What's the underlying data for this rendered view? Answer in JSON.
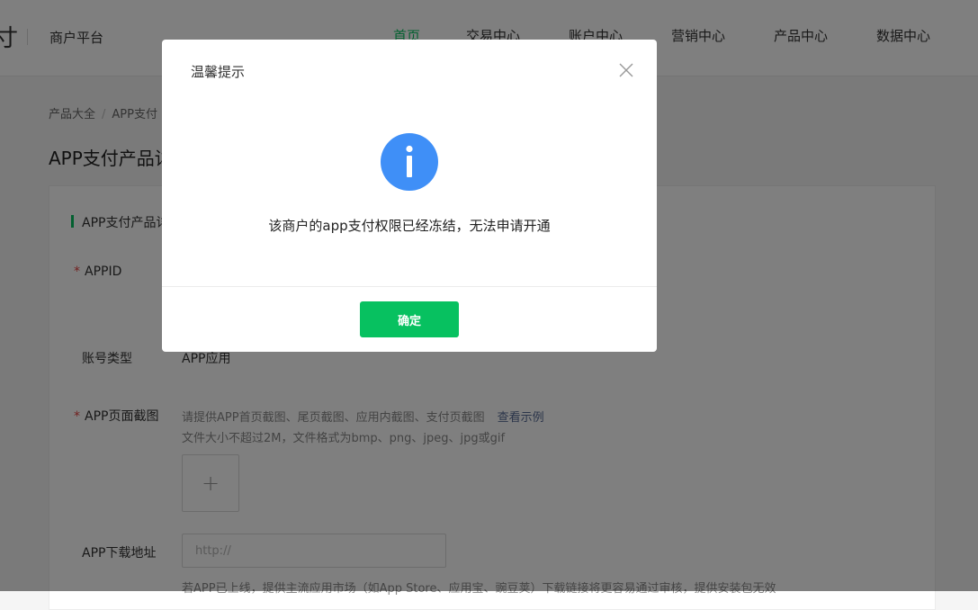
{
  "header": {
    "logo_fragment": "寸",
    "platform": "商户平台",
    "nav": [
      {
        "label": "首页",
        "active": true
      },
      {
        "label": "交易中心"
      },
      {
        "label": "账户中心"
      },
      {
        "label": "营销中心"
      },
      {
        "label": "产品中心"
      },
      {
        "label": "数据中心"
      }
    ]
  },
  "breadcrumb": [
    "产品大全",
    "APP支付"
  ],
  "page_title": "APP支付产品详",
  "section_title": "APP支付产品详",
  "form": {
    "appid_label": "APPID",
    "account_type_label": "账号类型",
    "account_type_value": "APP应用",
    "screenshots_label": "APP页面截图",
    "screenshots_hint": "请提供APP首页截图、尾页截图、应用内截图、支付页截图",
    "screenshots_link": "查看示例",
    "screenshots_hint2": "文件大小不超过2M，文件格式为bmp、png、jpeg、jpg或gif",
    "upload_plus": "+",
    "download_label": "APP下载地址",
    "download_placeholder": "http://",
    "download_hint": "若APP已上线，提供主流应用市场（如App Store、应用宝、豌豆荚）下载链接将更容易通过审核，提供安装包无效"
  },
  "modal": {
    "title": "温馨提示",
    "message": "该商户的app支付权限已经冻结，无法申请开通",
    "confirm_label": "确定",
    "icon": "info-icon",
    "close_icon": "close-icon"
  },
  "colors": {
    "accent": "#07c160",
    "info_blue": "#3f8ff7",
    "link": "#576b95",
    "required": "#e64340"
  }
}
